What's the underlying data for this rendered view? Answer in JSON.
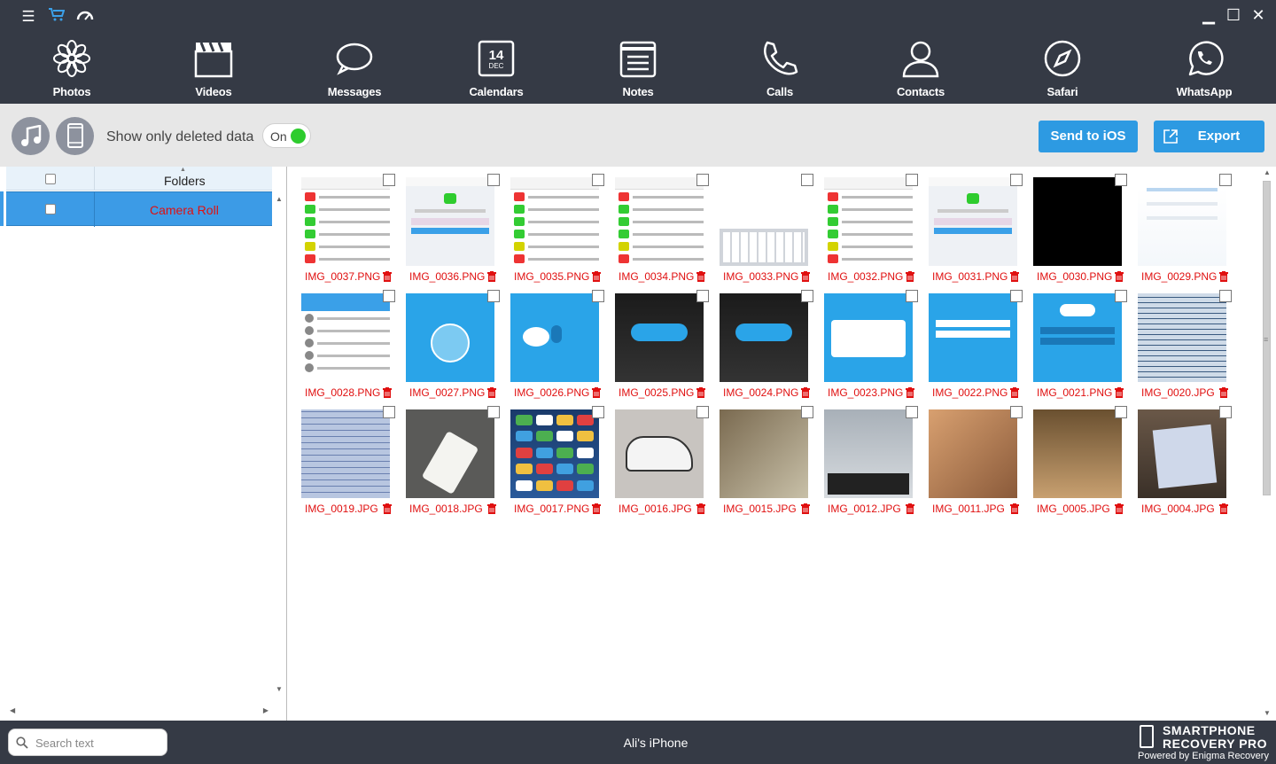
{
  "nav": [
    {
      "label": "Photos",
      "icon": "flower-icon"
    },
    {
      "label": "Videos",
      "icon": "clapper-icon"
    },
    {
      "label": "Messages",
      "icon": "speech-bubble-icon"
    },
    {
      "label": "Calendars",
      "icon": "calendar-icon"
    },
    {
      "label": "Notes",
      "icon": "notes-icon"
    },
    {
      "label": "Calls",
      "icon": "phone-icon"
    },
    {
      "label": "Contacts",
      "icon": "person-icon"
    },
    {
      "label": "Safari",
      "icon": "compass-icon"
    },
    {
      "label": "WhatsApp",
      "icon": "whatsapp-icon"
    }
  ],
  "calendar_icon": {
    "day": "14",
    "month": "DEC"
  },
  "toolbar": {
    "deleted_label": "Show only deleted data",
    "toggle_label": "On",
    "send_label": "Send to iOS",
    "export_label": "Export"
  },
  "folders": {
    "header": "Folders",
    "items": [
      "Camera Roll"
    ]
  },
  "files": [
    {
      "name": "IMG_0037.PNG",
      "style": "list"
    },
    {
      "name": "IMG_0036.PNG",
      "style": "lock"
    },
    {
      "name": "IMG_0035.PNG",
      "style": "list"
    },
    {
      "name": "IMG_0034.PNG",
      "style": "list"
    },
    {
      "name": "IMG_0033.PNG",
      "style": "keyboard"
    },
    {
      "name": "IMG_0032.PNG",
      "style": "list"
    },
    {
      "name": "IMG_0031.PNG",
      "style": "lock"
    },
    {
      "name": "IMG_0030.PNG",
      "style": "black"
    },
    {
      "name": "IMG_0029.PNG",
      "style": "faded"
    },
    {
      "name": "IMG_0028.PNG",
      "style": "skypelist"
    },
    {
      "name": "IMG_0027.PNG",
      "style": "bluecam"
    },
    {
      "name": "IMG_0026.PNG",
      "style": "bluemic"
    },
    {
      "name": "IMG_0025.PNG",
      "style": "skypedark"
    },
    {
      "name": "IMG_0024.PNG",
      "style": "skypedark"
    },
    {
      "name": "IMG_0023.PNG",
      "style": "bluedialog"
    },
    {
      "name": "IMG_0022.PNG",
      "style": "bluelogin"
    },
    {
      "name": "IMG_0021.PNG",
      "style": "bluelogo"
    },
    {
      "name": "IMG_0020.JPG",
      "style": "spreadsheet"
    },
    {
      "name": "IMG_0019.JPG",
      "style": "spreadsheet2"
    },
    {
      "name": "IMG_0018.JPG",
      "style": "phone"
    },
    {
      "name": "IMG_0017.PNG",
      "style": "homescreen"
    },
    {
      "name": "IMG_0016.JPG",
      "style": "car"
    },
    {
      "name": "IMG_0015.JPG",
      "style": "room"
    },
    {
      "name": "IMG_0012.JPG",
      "style": "desk"
    },
    {
      "name": "IMG_0011.JPG",
      "style": "blur"
    },
    {
      "name": "IMG_0005.JPG",
      "style": "office"
    },
    {
      "name": "IMG_0004.JPG",
      "style": "monitor"
    }
  ],
  "search": {
    "placeholder": "Search text"
  },
  "device_name": "Ali's iPhone",
  "brand": {
    "line1": "SMARTPHONE",
    "line2": "RECOVERY PRO",
    "line3": "Powered by Enigma Recovery"
  },
  "colors": {
    "accent": "#2d9ae2",
    "topbar": "#353a45",
    "filename": "#e01010",
    "toggle_on": "#2ecc2e"
  }
}
